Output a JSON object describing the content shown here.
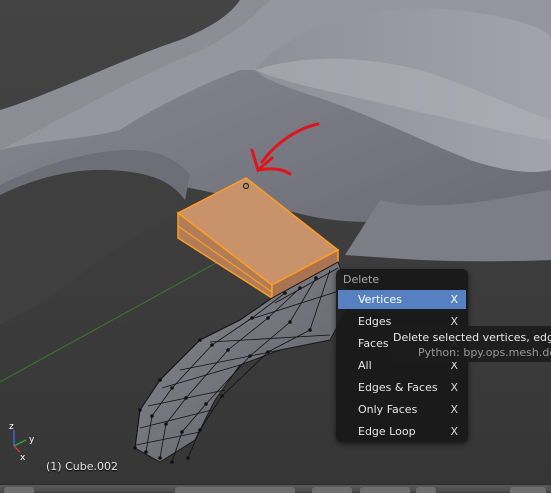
{
  "delete_menu": {
    "title": "Delete",
    "items": [
      {
        "label": "Vertices",
        "key": "X"
      },
      {
        "label": "Edges",
        "key": "X"
      },
      {
        "label": "Faces",
        "key": "X"
      },
      {
        "label": "All",
        "key": "X"
      },
      {
        "label": "Edges & Faces",
        "key": "X"
      },
      {
        "label": "Only Faces",
        "key": "X"
      },
      {
        "label": "Edge Loop",
        "key": "X"
      }
    ],
    "highlighted": "Vertices"
  },
  "tooltip": {
    "description": "Delete selected vertices, edges",
    "python": "Python: bpy.ops.mesh.delet"
  },
  "viewport": {
    "object_info": "(1) Cube.002",
    "axis_labels": {
      "x": "x",
      "y": "y",
      "z": "z"
    }
  },
  "colors": {
    "selected_face": "#c8936a",
    "selected_edge": "#ff9d22",
    "menu_highlight": "#5680c2",
    "annotation_arrow": "#e0141c"
  }
}
